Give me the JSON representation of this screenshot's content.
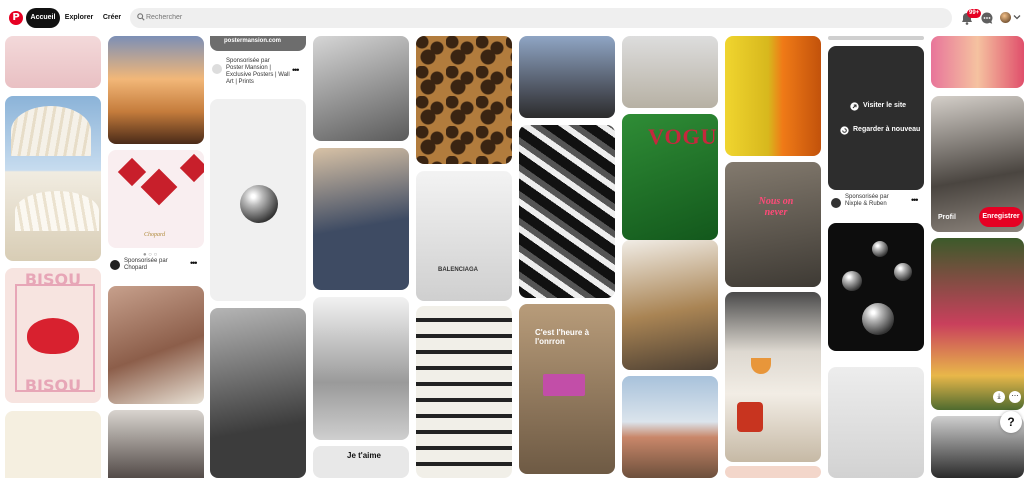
{
  "header": {
    "logo_icon": "pinterest-logo-icon",
    "nav": {
      "home": "Accueil",
      "explore": "Explorer",
      "create": "Créer"
    },
    "search": {
      "placeholder": "Rechercher"
    },
    "notification_badge": "99+"
  },
  "pins": {
    "poster_mansion": {
      "image_text": "postermansion.com",
      "sponsored_label": "Sponsorisée par",
      "advertiser": "Poster Mansion | Exclusive Posters | Wall Art | Prints"
    },
    "chopard": {
      "sponsored_label": "Sponsorisée par",
      "advertiser": "Chopard",
      "image_text": "Chopard"
    },
    "bisou": {
      "top_text": "BISOU",
      "bottom_text": "BISOU"
    },
    "vogue": {
      "image_text": "VOGUE"
    },
    "neon": {
      "image_text": "Nous on never"
    },
    "cat_ad": {
      "image_text": "C'est l'heure à l'onrron"
    },
    "nixple": {
      "visit_label": "Visiter le site",
      "rewatch_label": "Regarder à nouveau",
      "sponsored_label": "Sponsorisée par",
      "advertiser": "Nixple & Ruben"
    },
    "flower": {
      "profile_label": "Profil",
      "save_label": "Enregistrer"
    },
    "books": {
      "image_text": "BALENCIAGA"
    },
    "jetaime": {
      "image_text": "Je t'aime"
    }
  },
  "help_label": "?",
  "colors": {
    "brand": "#e60023",
    "nav_active": "#111111",
    "search_bg": "#efefef"
  }
}
